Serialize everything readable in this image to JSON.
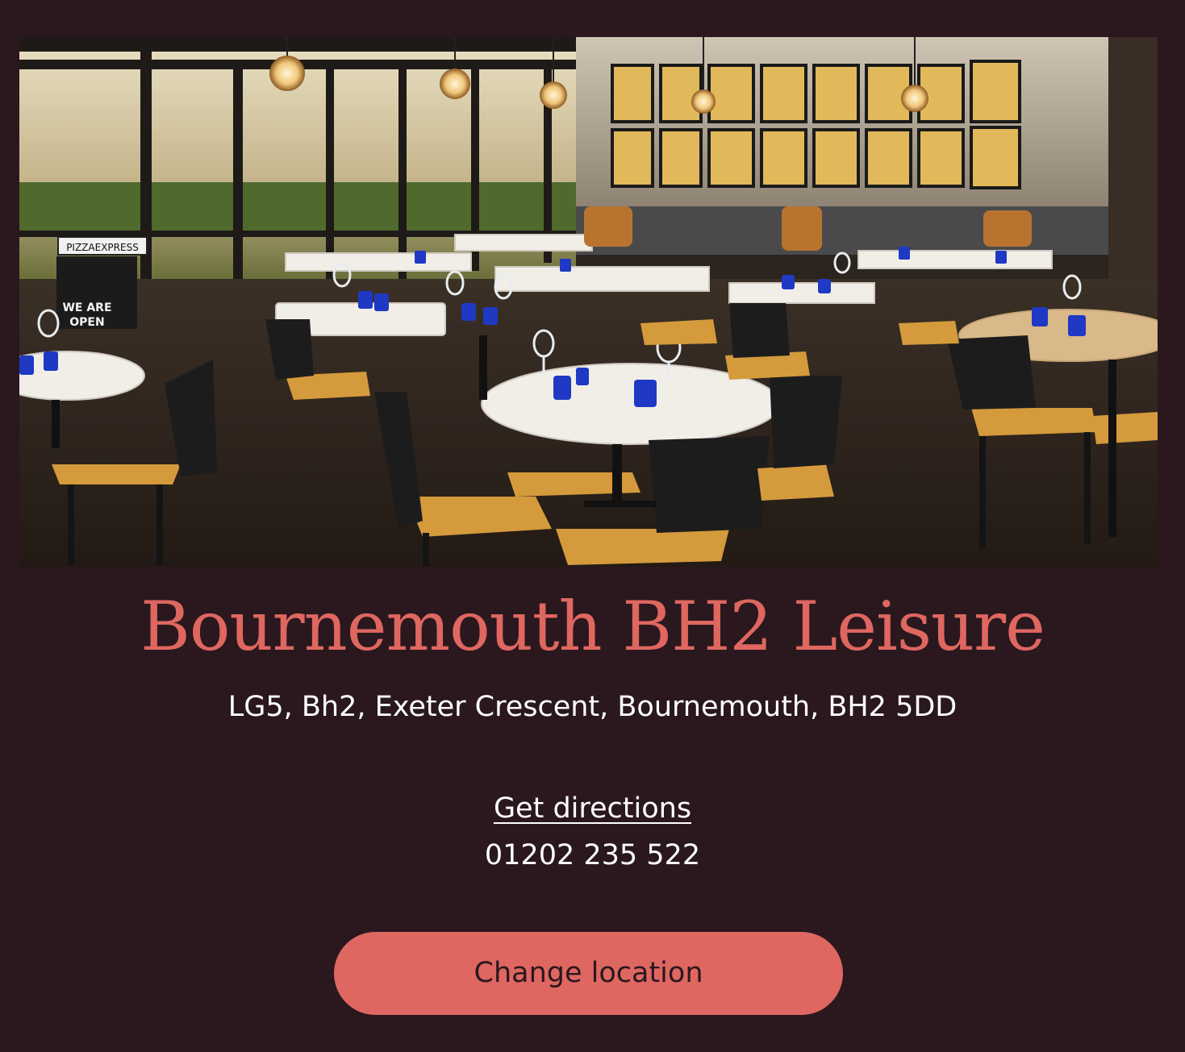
{
  "restaurant": {
    "name": "Bournemouth BH2 Leisure",
    "address": "LG5, Bh2, Exeter Crescent, Bournemouth, BH2 5DD",
    "directions_label": "Get directions",
    "phone": "01202 235 522"
  },
  "hero_image": {
    "subject": "restaurant-interior-photo",
    "sign_text_brand": "PIZZAEXPRESS",
    "sign_text_open": "WE ARE OPEN"
  },
  "actions": {
    "change_location_label": "Change location"
  },
  "colors": {
    "background": "#2a181e",
    "accent": "#df6761",
    "text": "#ffffff"
  }
}
